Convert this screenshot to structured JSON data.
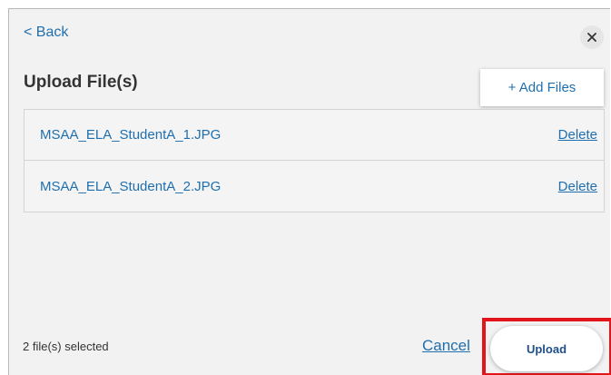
{
  "header": {
    "back_label": "< Back",
    "close_icon": "close-icon"
  },
  "title": "Upload File(s)",
  "add_files_label": "+ Add Files",
  "files": [
    {
      "name": "MSAA_ELA_StudentA_1.JPG",
      "delete_label": "Delete"
    },
    {
      "name": "MSAA_ELA_StudentA_2.JPG",
      "delete_label": "Delete"
    }
  ],
  "footer": {
    "status": "2 file(s) selected",
    "cancel_label": "Cancel",
    "upload_label": "Upload"
  },
  "colors": {
    "link_blue": "#1f6fae",
    "highlight_red": "#e3151a",
    "dialog_bg": "#f2f2f2"
  }
}
